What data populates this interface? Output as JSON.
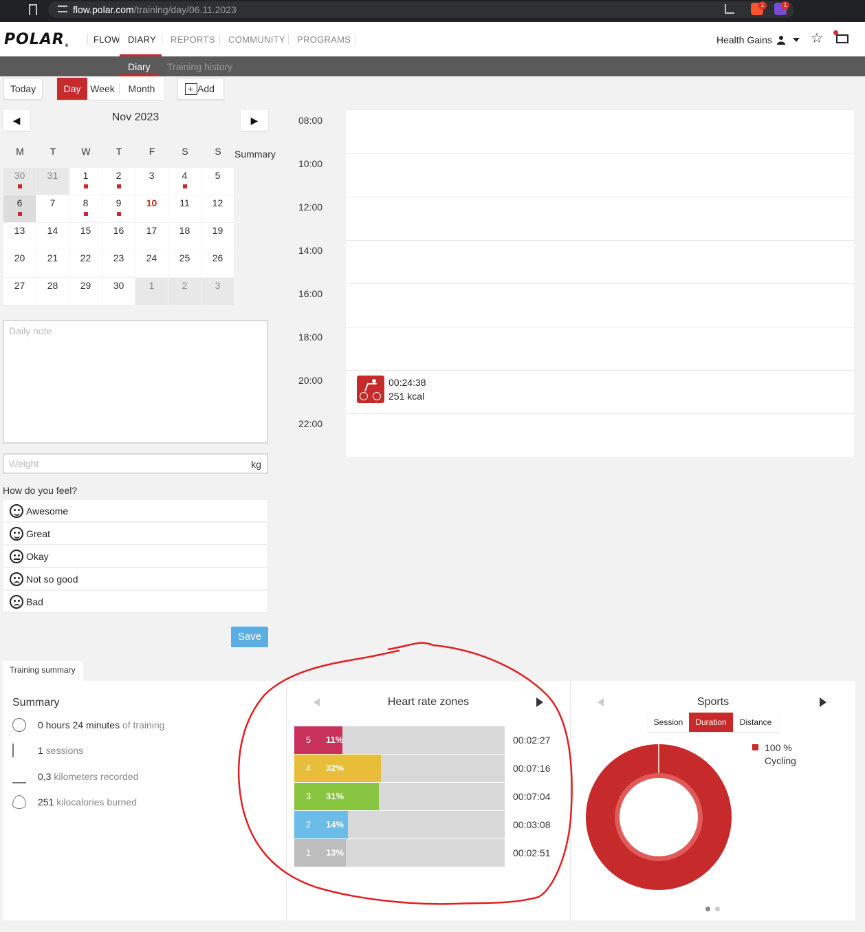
{
  "browser": {
    "url_host": "flow.polar.com",
    "url_path": "/training/day/06.11.2023",
    "brave_badge": "1",
    "rewards_badge": "1"
  },
  "nav": {
    "logo": "POLAR",
    "items": [
      "FLOW",
      "DIARY",
      "REPORTS",
      "COMMUNITY",
      "PROGRAMS"
    ],
    "active": "DIARY",
    "user": "Health Gains"
  },
  "subnav": {
    "items": [
      "Diary",
      "Training history"
    ],
    "active": "Diary"
  },
  "toolbar": {
    "today": "Today",
    "day": "Day",
    "week": "Week",
    "month": "Month",
    "add": "Add",
    "active_view": "Day"
  },
  "calendar": {
    "month": "Nov 2023",
    "prev": "◀",
    "next": "▶",
    "weekdays": [
      "M",
      "T",
      "W",
      "T",
      "F",
      "S",
      "S"
    ],
    "summary_label": "Summary",
    "weeks": [
      [
        {
          "d": "30",
          "o": true,
          "dot": true
        },
        {
          "d": "31",
          "o": true
        },
        {
          "d": "1",
          "dot": true
        },
        {
          "d": "2",
          "dot": true
        },
        {
          "d": "3"
        },
        {
          "d": "4",
          "dot": true
        },
        {
          "d": "5"
        }
      ],
      [
        {
          "d": "6",
          "sel": true,
          "dot": true
        },
        {
          "d": "7"
        },
        {
          "d": "8",
          "dot": true
        },
        {
          "d": "9",
          "dot": true
        },
        {
          "d": "10",
          "today": true
        },
        {
          "d": "11"
        },
        {
          "d": "12"
        }
      ],
      [
        {
          "d": "13"
        },
        {
          "d": "14"
        },
        {
          "d": "15"
        },
        {
          "d": "16"
        },
        {
          "d": "17"
        },
        {
          "d": "18"
        },
        {
          "d": "19"
        }
      ],
      [
        {
          "d": "20"
        },
        {
          "d": "21"
        },
        {
          "d": "22"
        },
        {
          "d": "23"
        },
        {
          "d": "24"
        },
        {
          "d": "25"
        },
        {
          "d": "26"
        }
      ],
      [
        {
          "d": "27"
        },
        {
          "d": "28"
        },
        {
          "d": "29"
        },
        {
          "d": "30"
        },
        {
          "d": "1",
          "o": true
        },
        {
          "d": "2",
          "o": true
        },
        {
          "d": "3",
          "o": true
        }
      ]
    ]
  },
  "daily_note": {
    "placeholder": "Daily note"
  },
  "weight": {
    "placeholder": "Weight",
    "unit": "kg"
  },
  "feel": {
    "title": "How do you feel?",
    "options": [
      {
        "label": "Awesome",
        "icon": "very-happy-face-icon"
      },
      {
        "label": "Great",
        "icon": "happy-face-icon"
      },
      {
        "label": "Okay",
        "icon": "neutral-face-icon"
      },
      {
        "label": "Not so good",
        "icon": "unhappy-face-icon"
      },
      {
        "label": "Bad",
        "icon": "sad-face-icon"
      }
    ],
    "save": "Save"
  },
  "timeline": {
    "times": [
      "08:00",
      "10:00",
      "12:00",
      "14:00",
      "16:00",
      "18:00",
      "20:00",
      "22:00"
    ],
    "session": {
      "sport_icon": "cycling-icon",
      "duration": "00:24:38",
      "kcal": "251 kcal"
    }
  },
  "training_summary": {
    "tab": "Training summary",
    "summary_title": "Summary",
    "rows": [
      {
        "icon": "stopwatch-icon",
        "value": "0 hours 24 minutes",
        "label": " of training"
      },
      {
        "icon": "tally-icon",
        "value": "1",
        "label": " sessions"
      },
      {
        "icon": "ruler-icon",
        "value": "0,3",
        "label": " kilometers recorded"
      },
      {
        "icon": "flame-icon",
        "value": "251",
        "label": " kilocalories burned"
      }
    ],
    "hr_title": "Heart rate zones",
    "hr_zones": [
      {
        "zone": "5",
        "percent": 11,
        "label": "11%",
        "time": "00:02:27",
        "color": "#c8315a"
      },
      {
        "zone": "4",
        "percent": 32,
        "label": "32%",
        "time": "00:07:16",
        "color": "#e8bd3a"
      },
      {
        "zone": "3",
        "percent": 31,
        "label": "31%",
        "time": "00:07:04",
        "color": "#88c540"
      },
      {
        "zone": "2",
        "percent": 14,
        "label": "14%",
        "time": "00:03:08",
        "color": "#6bbce8"
      },
      {
        "zone": "1",
        "percent": 13,
        "label": "13%",
        "time": "00:02:51",
        "color": "#bdbdbd"
      }
    ],
    "sports_title": "Sports",
    "sports_tabs": [
      "Session",
      "Duration",
      "Distance"
    ],
    "sports_active_tab": "Duration",
    "sports_legend": {
      "percent": "100 %",
      "sport": "Cycling",
      "color": "#c62a2a"
    },
    "pager_pages": 2,
    "pager_current": 1
  },
  "colors": {
    "accent": "#c62a2a",
    "annotation": "#e02020"
  }
}
